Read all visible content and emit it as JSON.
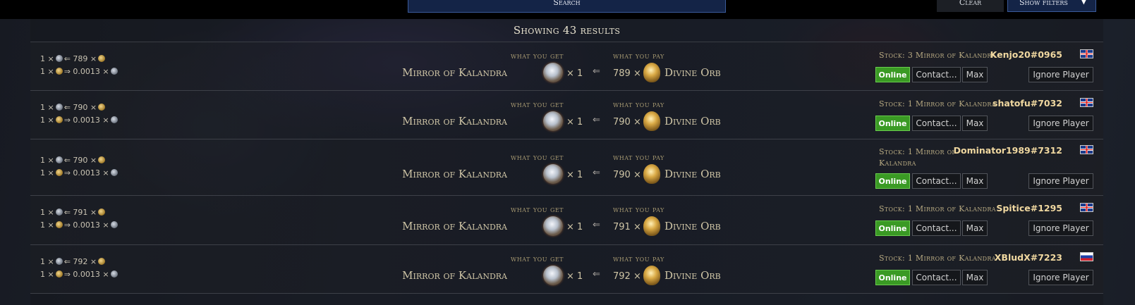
{
  "top": {
    "search_label": "Search",
    "clear_label": "Clear",
    "filters_label": "Show filters"
  },
  "results_header": "Showing 43 results",
  "labels": {
    "what_you_get": "what you get",
    "what_you_pay": "what you pay",
    "arrow": "⇐",
    "online": "Online",
    "contact": "Contact...",
    "max": "Max",
    "ignore": "Ignore Player"
  },
  "rows": [
    {
      "ratio_line1_a": "1 ×",
      "ratio_line1_b": "⇐ 789 ×",
      "ratio_line2_a": "1 ×",
      "ratio_line2_b": "⇒ 0.0013 ×",
      "get_item": "Mirror of Kalandra",
      "get_mult": "× 1",
      "pay_amount": "789 ×",
      "pay_item": "Divine Orb",
      "stock": "Stock: 3 Mirror of Kalandra",
      "player": "Kenjo20#0965",
      "flag": "uk"
    },
    {
      "ratio_line1_a": "1 ×",
      "ratio_line1_b": "⇐ 790 ×",
      "ratio_line2_a": "1 ×",
      "ratio_line2_b": "⇒ 0.0013 ×",
      "get_item": "Mirror of Kalandra",
      "get_mult": "× 1",
      "pay_amount": "790 ×",
      "pay_item": "Divine Orb",
      "stock": "Stock: 1 Mirror of Kalandra",
      "player": "shatofu#7032",
      "flag": "uk"
    },
    {
      "ratio_line1_a": "1 ×",
      "ratio_line1_b": "⇐ 790 ×",
      "ratio_line2_a": "1 ×",
      "ratio_line2_b": "⇒ 0.0013 ×",
      "get_item": "Mirror of Kalandra",
      "get_mult": "× 1",
      "pay_amount": "790 ×",
      "pay_item": "Divine Orb",
      "stock": "Stock: 1 Mirror of Kalandra",
      "player": "Dominator1989#7312",
      "flag": "uk"
    },
    {
      "ratio_line1_a": "1 ×",
      "ratio_line1_b": "⇐ 791 ×",
      "ratio_line2_a": "1 ×",
      "ratio_line2_b": "⇒ 0.0013 ×",
      "get_item": "Mirror of Kalandra",
      "get_mult": "× 1",
      "pay_amount": "791 ×",
      "pay_item": "Divine Orb",
      "stock": "Stock: 1 Mirror of Kalandra",
      "player": "Spitice#1295",
      "flag": "uk"
    },
    {
      "ratio_line1_a": "1 ×",
      "ratio_line1_b": "⇐ 792 ×",
      "ratio_line2_a": "1 ×",
      "ratio_line2_b": "⇒ 0.0013 ×",
      "get_item": "Mirror of Kalandra",
      "get_mult": "× 1",
      "pay_amount": "792 ×",
      "pay_item": "Divine Orb",
      "stock": "Stock: 1 Mirror of Kalandra",
      "player": "XBludX#7223",
      "flag": "ru"
    }
  ]
}
